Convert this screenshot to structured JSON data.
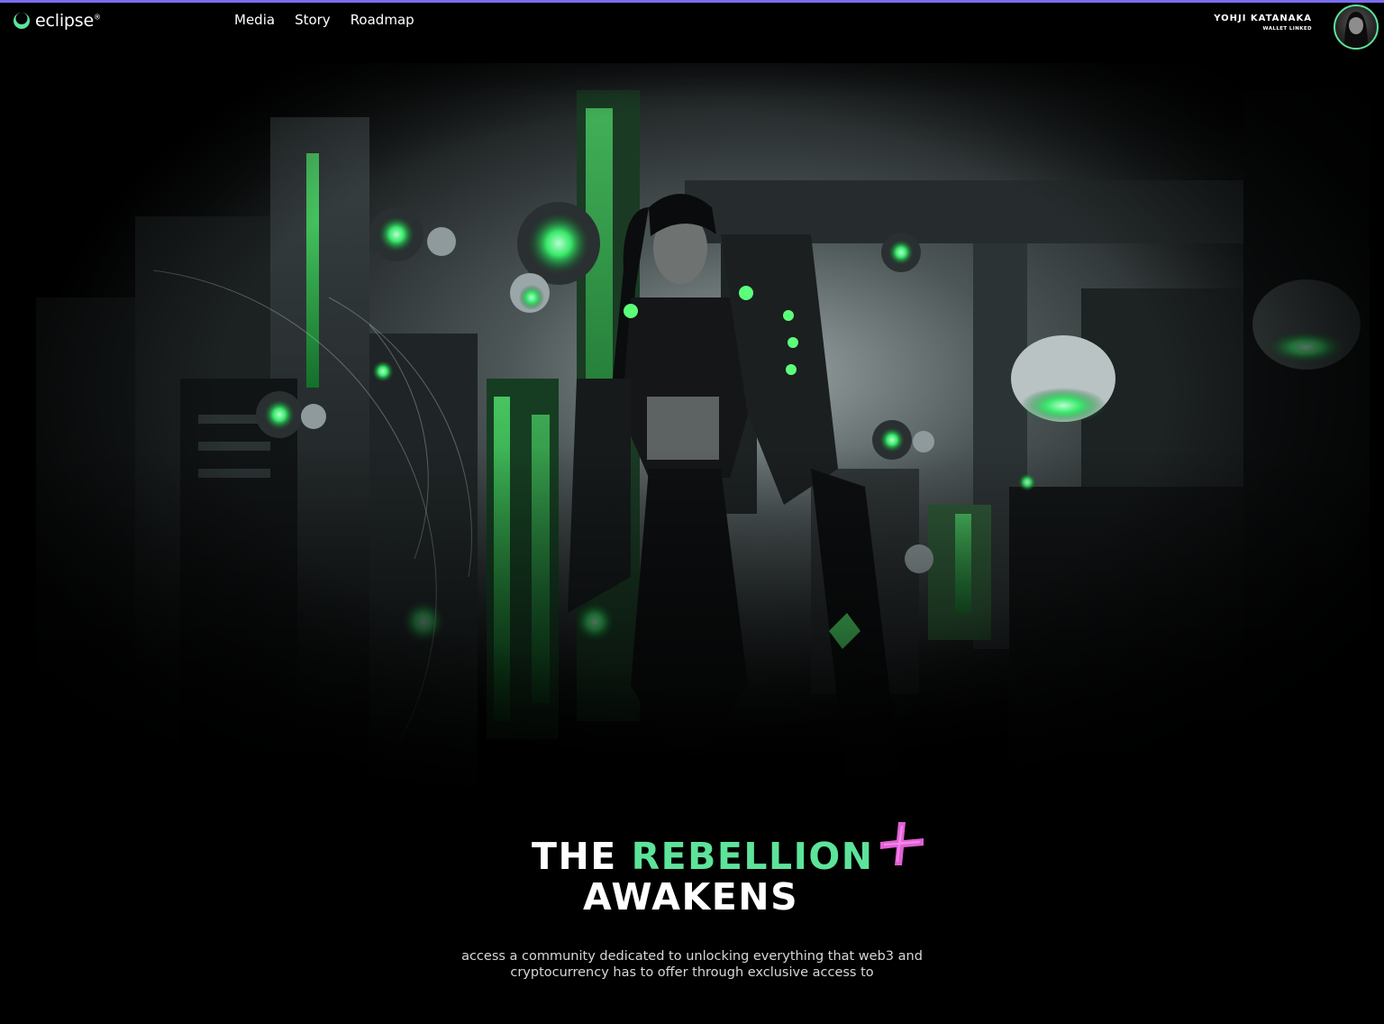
{
  "brand": {
    "name": "eclipse",
    "logo_icon": "eclipse-logo-icon",
    "trademark": "®"
  },
  "nav": {
    "items": [
      {
        "label": "Media"
      },
      {
        "label": "Story"
      },
      {
        "label": "Roadmap"
      }
    ]
  },
  "user": {
    "name": "YOHJI KATANAKA",
    "status": "WALLET LINKED"
  },
  "hero": {
    "title_line1_part1": "THE ",
    "title_line1_accent": "REBELLION",
    "title_line2": "AWAKENS",
    "subtitle_line1": "access a community dedicated to unlocking everything that web3 and",
    "subtitle_line2": "cryptocurrency has to offer through exclusive access to"
  },
  "colors": {
    "accent_green": "#5de39a",
    "accent_purple": "#7b6cf0",
    "accent_pink": "#e35fd6",
    "background": "#000000"
  }
}
